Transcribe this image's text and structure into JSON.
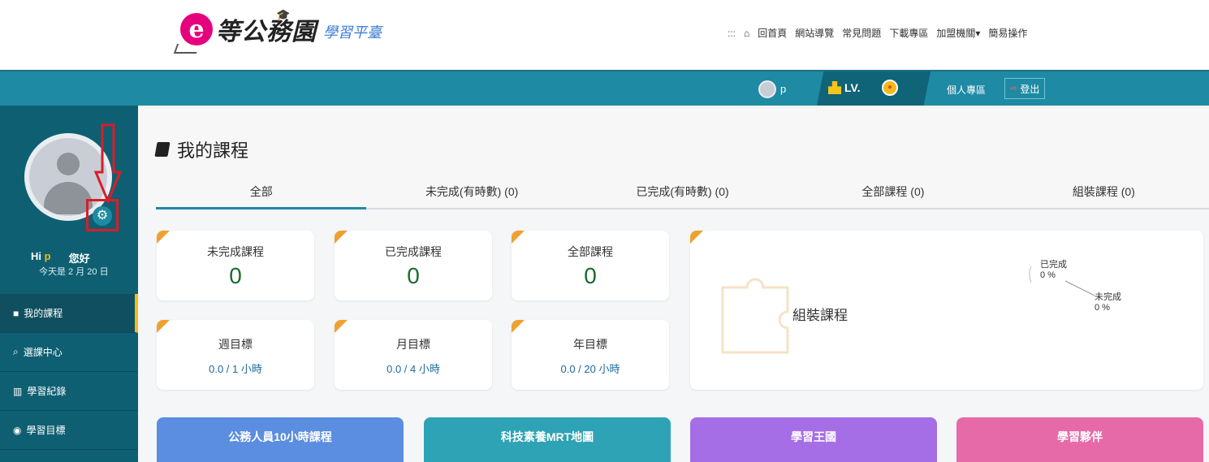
{
  "header": {
    "logo_mark": "e",
    "logo_title": "等公務園",
    "logo_subtitle": "學習平臺",
    "nav_dots": ":::",
    "nav_items": [
      "回首頁",
      "網站導覽",
      "常見問題",
      "下載專區",
      "加盟機關▾",
      "簡易操作"
    ]
  },
  "mainbar": {
    "user_name": "p",
    "level_label": "LV.",
    "personal_area": "個人專區",
    "logout": "登出"
  },
  "sidebar": {
    "greeting_hi": "Hi",
    "user_name": "p",
    "greeting_suffix": "您好",
    "date_text": "今天是 2 月 20 日",
    "items": [
      {
        "label": "我的課程",
        "icon": "book-icon"
      },
      {
        "label": "選課中心",
        "icon": "search-icon"
      },
      {
        "label": "學習紀錄",
        "icon": "bar-chart-icon"
      },
      {
        "label": "學習目標",
        "icon": "target-icon"
      }
    ]
  },
  "main": {
    "title": "我的課程",
    "tabs": [
      "全部",
      "未完成(有時數) (0)",
      "已完成(有時數) (0)",
      "全部課程 (0)",
      "組裝課程 (0)"
    ],
    "stats": [
      {
        "label": "未完成課程",
        "value": "0"
      },
      {
        "label": "已完成課程",
        "value": "0"
      },
      {
        "label": "全部課程",
        "value": "0"
      }
    ],
    "goals": [
      {
        "label": "週目標",
        "value": "0.0 / 1 小時"
      },
      {
        "label": "月目標",
        "value": "0.0 / 4 小時"
      },
      {
        "label": "年目標",
        "value": "0.0 / 20 小時"
      }
    ],
    "assembly": {
      "title": "組裝課程",
      "completed_label": "已完成",
      "completed_pct": "0 %",
      "incomplete_label": "未完成",
      "incomplete_pct": "0 %"
    },
    "features": [
      {
        "label": "公務人員10小時課程",
        "color": "#5b8de0"
      },
      {
        "label": "科技素養MRT地圖",
        "color": "#2ea3b5"
      },
      {
        "label": "學習王國",
        "color": "#a66ee6"
      },
      {
        "label": "學習夥伴",
        "color": "#e66aa8"
      }
    ]
  },
  "colors": {
    "brand_teal": "#1e8aa4",
    "sidebar_bg": "#0f5f72",
    "accent_yellow": "#f5b91b",
    "highlight_red": "#d91d2a"
  }
}
